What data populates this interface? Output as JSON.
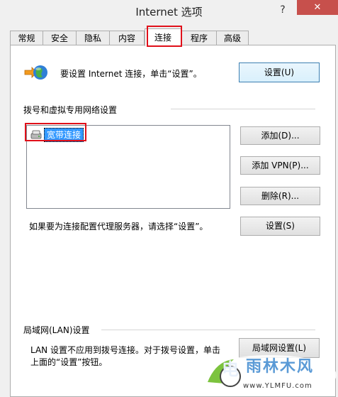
{
  "window": {
    "title": "Internet 选项",
    "help_label": "?",
    "close_label": "✕"
  },
  "tabs": [
    {
      "label": "常规",
      "active": false
    },
    {
      "label": "安全",
      "active": false
    },
    {
      "label": "隐私",
      "active": false
    },
    {
      "label": "内容",
      "active": false
    },
    {
      "label": "连接",
      "active": true
    },
    {
      "label": "程序",
      "active": false
    },
    {
      "label": "高级",
      "active": false
    }
  ],
  "connect": {
    "setup_text": "要设置 Internet 连接，单击“设置”。",
    "setup_button": "设置(U)",
    "icon": "globe-network-icon"
  },
  "dialup": {
    "section_label": "拨号和虚拟专用网络设置",
    "items": [
      {
        "label": "宽带连接",
        "icon": "modem-connection-icon",
        "selected": true
      }
    ],
    "add_button": "添加(D)...",
    "add_vpn_button": "添加 VPN(P)...",
    "delete_button": "删除(R)...",
    "proxy_text": "如果要为连接配置代理服务器，请选择“设置”。",
    "settings_button": "设置(S)"
  },
  "lan": {
    "section_label": "局域网(LAN)设置",
    "text_line1": "LAN 设置不应用到拨号连接。对于拨号设置，单击",
    "text_line2": "上面的“设置”按钮。",
    "lan_button": "局域网设置(L)"
  },
  "watermark": {
    "name": "雨林木风",
    "url": "www.YLMFU.com",
    "mark": "电"
  }
}
